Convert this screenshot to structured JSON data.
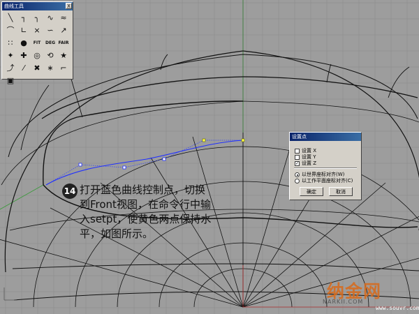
{
  "palette": {
    "title": "曲线工具",
    "close_label": "X",
    "tools": [
      {
        "icon": "polyline-icon",
        "glyph": "╲"
      },
      {
        "icon": "corner-curve-icon",
        "glyph": "┐"
      },
      {
        "icon": "curve-corner-icon",
        "glyph": "╮"
      },
      {
        "icon": "s-curve-icon",
        "glyph": "∿"
      },
      {
        "icon": "blend-curve-icon",
        "glyph": "≈"
      },
      {
        "icon": "arc-curve-icon",
        "glyph": "⌒"
      },
      {
        "icon": "sweep-icon",
        "glyph": "∟"
      },
      {
        "icon": "curve-network-icon",
        "glyph": "⨯"
      },
      {
        "icon": "spline-icon",
        "glyph": "∽"
      },
      {
        "icon": "rebuild-icon",
        "glyph": "↗"
      },
      {
        "icon": "point-edit-icon",
        "glyph": "∷"
      },
      {
        "icon": "globe-icon",
        "glyph": "●"
      },
      {
        "icon": "fit-curve-icon",
        "glyph": "FIT"
      },
      {
        "icon": "degree-icon",
        "glyph": "DEG"
      },
      {
        "icon": "fair-curve-icon",
        "glyph": "FAIR"
      },
      {
        "icon": "control-point-icon",
        "glyph": "✦"
      },
      {
        "icon": "insert-knot-icon",
        "glyph": "✚"
      },
      {
        "icon": "offset-curve-icon",
        "glyph": "◎"
      },
      {
        "icon": "extend-curve-icon",
        "glyph": "⟲"
      },
      {
        "icon": "tweak-curve-icon",
        "glyph": "★"
      },
      {
        "icon": "project-curve-icon",
        "glyph": "⤴"
      },
      {
        "icon": "split-curve-icon",
        "glyph": "⁄"
      },
      {
        "icon": "delete-point-icon",
        "glyph": "✖"
      },
      {
        "icon": "match-curve-icon",
        "glyph": "∗"
      },
      {
        "icon": "pull-curve-icon",
        "glyph": "⌐"
      },
      {
        "icon": "more-tools-icon",
        "glyph": "▣"
      }
    ]
  },
  "dialog": {
    "title": "设置点",
    "options": [
      {
        "label": "设置 X",
        "checked": false
      },
      {
        "label": "设置 Y",
        "checked": false
      },
      {
        "label": "设置 Z",
        "checked": true
      }
    ],
    "align": [
      {
        "label": "以世界座标对齐(W)",
        "selected": true
      },
      {
        "label": "以工作平面座标对齐(C)",
        "selected": false
      }
    ],
    "ok_label": "确定",
    "cancel_label": "取消"
  },
  "annotation": {
    "step_number": "14",
    "lines": [
      "打开蓝色曲线控制点，切换",
      "到Front视图，在命令行中输",
      "入setpt，使黄色两点保持水",
      "平，如图所示。"
    ]
  },
  "watermark": {
    "logo": "纳金网",
    "site": "NARKII.COM",
    "url": "www.souvr.com"
  },
  "colors": {
    "viewport_bg": "#9d9d9d",
    "grid_line": "#8a8a8a",
    "wire": "#111111",
    "blue_curve": "#2a3cff",
    "control_point": "#ffff66",
    "axis_red": "#b03030",
    "axis_green": "#2e8a2e"
  }
}
